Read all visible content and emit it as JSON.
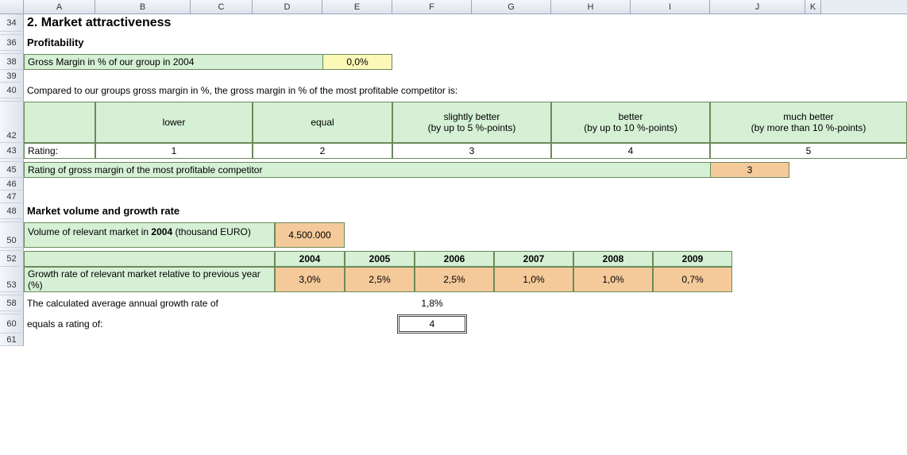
{
  "cols": [
    "A",
    "B",
    "C",
    "D",
    "E",
    "F",
    "G",
    "H",
    "I",
    "J",
    "K"
  ],
  "rows": {
    "r34": "34",
    "r36": "36",
    "r38": "38",
    "r39": "39",
    "r40": "40",
    "r42": "42",
    "r43": "43",
    "r45": "45",
    "r46": "46",
    "r47": "47",
    "r48": "48",
    "r50": "50",
    "r52": "52",
    "r53": "53",
    "r58": "58",
    "r60": "60",
    "r61": "61"
  },
  "section_title": "2. Market attractiveness",
  "profitability_label": "Profitability",
  "gross_margin": {
    "label": "Gross Margin in % of our group in 2004",
    "value": "0,0%"
  },
  "comparison_text": "Compared to our groups gross margin in %, the gross margin in % of the most profitable competitor is:",
  "scale": {
    "headers": [
      "lower",
      "equal",
      "slightly better\n(by up to 5 %-points)",
      "better\n(by up to 10 %-points)",
      "much better\n(by more than 10 %-points)"
    ],
    "rating_label": "Rating:",
    "ratings": [
      "1",
      "2",
      "3",
      "4",
      "5"
    ]
  },
  "rating_competitor": {
    "label": "Rating of gross margin of the most profitable competitor",
    "value": "3"
  },
  "market_volume_label": "Market volume and growth rate",
  "volume": {
    "label_pre": "Volume of relevant market in ",
    "label_bold": "2004",
    "label_post": " (thousand EURO)",
    "value": "4.500.000"
  },
  "growth": {
    "years": [
      "2004",
      "2005",
      "2006",
      "2007",
      "2008",
      "2009"
    ],
    "row_label": "Growth rate of relevant market relative to previous year (%)",
    "values": [
      "3,0%",
      "2,5%",
      "2,5%",
      "1,0%",
      "1,0%",
      "0,7%"
    ]
  },
  "avg_growth": {
    "label": "The calculated average annual growth rate of",
    "value": "1,8%"
  },
  "equals_rating": {
    "label": "equals a rating of:",
    "value": "4"
  }
}
